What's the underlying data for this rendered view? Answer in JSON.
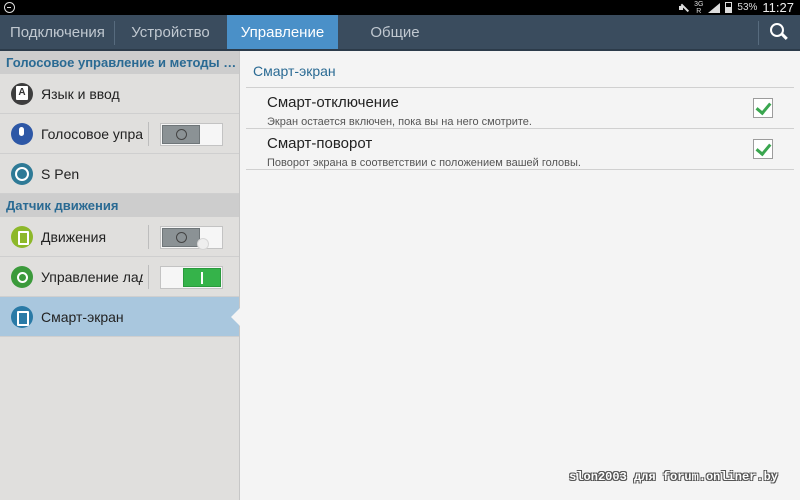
{
  "status_bar": {
    "network_label": "3G\nR",
    "battery_percent": "53%",
    "time": "11:27"
  },
  "tabs": [
    {
      "label": "Подключения",
      "active": false
    },
    {
      "label": "Устройство",
      "active": false
    },
    {
      "label": "Управление",
      "active": true
    },
    {
      "label": "Общие",
      "active": false
    }
  ],
  "sidebar": {
    "sections": [
      {
        "title": "Голосовое управление и методы в...",
        "items": [
          {
            "label": "Язык и ввод",
            "icon": "language-icon",
            "toggle": null
          },
          {
            "label": "Голосовое упра",
            "icon": "voice-control-icon",
            "toggle": "off"
          },
          {
            "label": "S Pen",
            "icon": "s-pen-icon",
            "toggle": null
          }
        ]
      },
      {
        "title": "Датчик движения",
        "items": [
          {
            "label": "Движения",
            "icon": "motion-icon",
            "toggle": "off"
          },
          {
            "label": "Управление лад",
            "icon": "palm-motion-icon",
            "toggle": "on"
          },
          {
            "label": "Смарт-экран",
            "icon": "smart-screen-icon",
            "toggle": null,
            "selected": true
          }
        ]
      }
    ]
  },
  "main": {
    "section_title": "Смарт-экран",
    "items": [
      {
        "title": "Смарт-отключение",
        "subtitle": "Экран остается включен, пока вы на него смотрите.",
        "checked": true
      },
      {
        "title": "Смарт-поворот",
        "subtitle": "Поворот экрана в соответствии с положением вашей головы.",
        "checked": true
      }
    ]
  },
  "watermark": "slon2003 для forum.onliner.by",
  "colors": {
    "tab_bar": "#3a4c5e",
    "tab_active": "#4a90c8",
    "section_header_text": "#2a6a93",
    "selected_item": "#a9c7de",
    "toggle_on": "#35b34a",
    "checkmark": "#3aa64f"
  }
}
